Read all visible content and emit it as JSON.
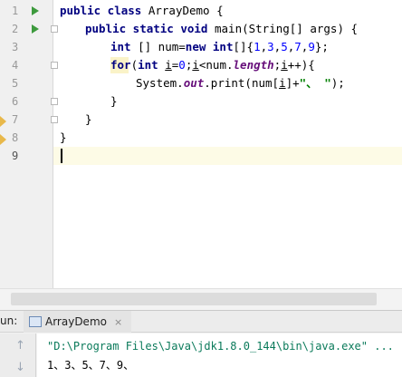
{
  "editor": {
    "line_numbers": [
      "1",
      "2",
      "3",
      "4",
      "5",
      "6",
      "7",
      "8",
      "9"
    ],
    "code": {
      "l1_kw": "public class",
      "l1_rest": " ArrayDemo {",
      "l2_kw": "public static void",
      "l2_rest": " main(String[] args) {",
      "l3_kw1": "int",
      "l3_mid1": " [] num=",
      "l3_kw2": "new int",
      "l3_mid2": "[]{",
      "l3_n1": "1",
      "l3_n2": "3",
      "l3_n3": "5",
      "l3_n4": "7",
      "l3_n5": "9",
      "l3_end": "};",
      "l4_kw": "for",
      "l4_a": "(",
      "l4_kw2": "int",
      "l4_b": " ",
      "l4_i1": "i",
      "l4_c": "=",
      "l4_n0": "0",
      "l4_d": ";",
      "l4_i2": "i",
      "l4_e": "<num.",
      "l4_field": "length",
      "l4_f": ";",
      "l4_i3": "i",
      "l4_g": "++){",
      "l5_a": "System.",
      "l5_out": "out",
      "l5_b": ".print(num[",
      "l5_i": "i",
      "l5_c": "]+",
      "l5_str": "\"、 \"",
      "l5_d": ");",
      "l6": "}",
      "l7": "}",
      "l8": "}"
    }
  },
  "run_panel": {
    "label": "un:",
    "tab_label": "ArrayDemo",
    "tab_close": "×",
    "toolbar": {
      "up": "↑",
      "down": "↓"
    },
    "console": {
      "command": "\"D:\\Program Files\\Java\\jdk1.8.0_144\\bin\\java.exe\" ...",
      "output": "1、3、5、7、9、"
    }
  },
  "colors": {
    "run_icon": "#3d9a3d",
    "keyword": "#000080",
    "number": "#0000ff",
    "string": "#008000",
    "field": "#660e7a",
    "console_command": "#0a7a5a",
    "current_line_bg": "#fdfbe6"
  }
}
